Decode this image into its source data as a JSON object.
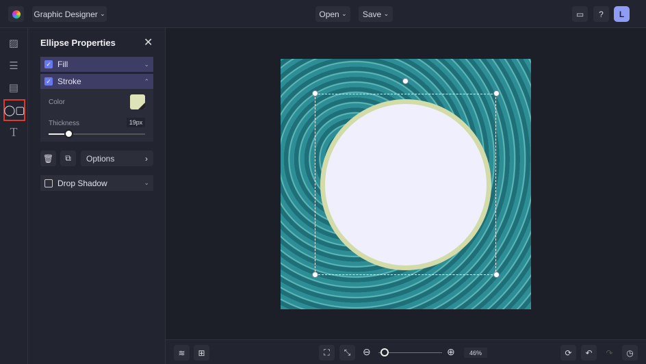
{
  "header": {
    "app_mode": "Graphic Designer",
    "open": "Open",
    "save": "Save",
    "avatar": "L"
  },
  "panel": {
    "title": "Ellipse Properties",
    "fill": "Fill",
    "stroke": "Stroke",
    "color_label": "Color",
    "thickness_label": "Thickness",
    "thickness_value": "19px",
    "thickness_fraction": 0.2,
    "options": "Options",
    "drop_shadow": "Drop Shadow",
    "stroke_color": "#dfe3b8"
  },
  "canvas": {
    "ellipse_fill": "#efeffd",
    "ellipse_stroke": "#d3dca9"
  },
  "footer": {
    "zoom": "46%",
    "zoom_fraction": 0.1
  }
}
